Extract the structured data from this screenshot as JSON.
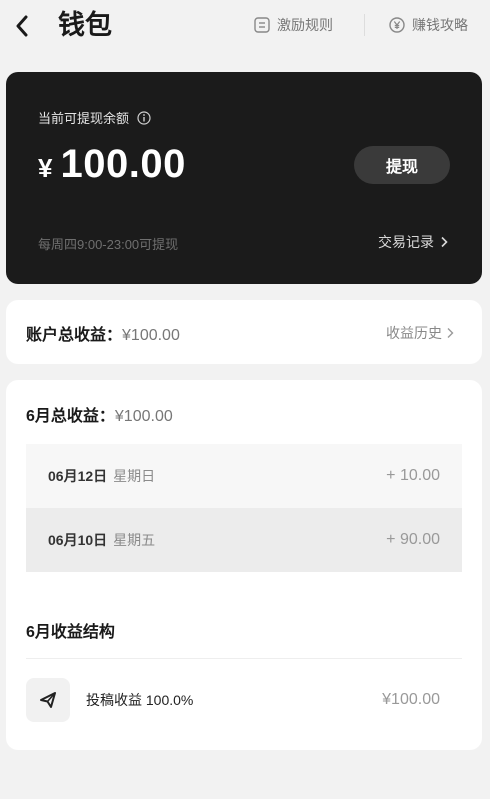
{
  "header": {
    "title": "钱包",
    "rules_label": "激励规则",
    "guide_label": "赚钱攻略"
  },
  "balance": {
    "label": "当前可提现余额",
    "currency": "¥",
    "amount": "100.00",
    "withdraw_label": "提现",
    "note": "每周四9:00-23:00可提现",
    "transactions_label": "交易记录"
  },
  "account_total": {
    "label": "账户总收益：",
    "value": "¥100.00",
    "history_label": "收益历史"
  },
  "month": {
    "label": "6月总收益：",
    "value": "¥100.00",
    "rows": [
      {
        "date": "06月12日",
        "weekday": "星期日",
        "amount": "+ 10.00"
      },
      {
        "date": "06月10日",
        "weekday": "星期五",
        "amount": "+ 90.00"
      }
    ],
    "structure_title": "6月收益结构",
    "structure": [
      {
        "icon": "paper-plane-icon",
        "label": "投稿收益 100.0%",
        "amount": "¥100.00"
      }
    ]
  },
  "colors": {
    "card_dark": "#1b1b1b",
    "background": "#f2f2f2"
  }
}
